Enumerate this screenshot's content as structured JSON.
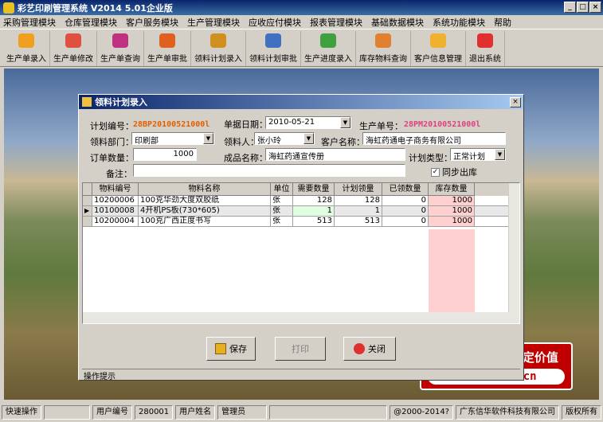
{
  "window": {
    "title": "彩艺印刷管理系统  V2014 5.01企业版"
  },
  "menu": [
    "采购管理模块",
    "仓库管理模块",
    "客户服务模块",
    "生产管理模块",
    "应收应付模块",
    "报表管理模块",
    "基础数据模块",
    "系统功能模块",
    "帮助"
  ],
  "toolbar": [
    {
      "label": "生产单录入",
      "color": "#f0a020"
    },
    {
      "label": "生产单修改",
      "color": "#e05040"
    },
    {
      "label": "生产单查询",
      "color": "#c03080"
    },
    {
      "label": "生产单审批",
      "color": "#e06020"
    },
    {
      "label": "领料计划录入",
      "color": "#d09020"
    },
    {
      "label": "领料计划审批",
      "color": "#4070c0"
    },
    {
      "label": "生产进度录入",
      "color": "#40a040"
    },
    {
      "label": "库存物料查询",
      "color": "#e08030"
    },
    {
      "label": "客户信息管理",
      "color": "#f0b030"
    },
    {
      "label": "退出系统",
      "color": "#e03030"
    }
  ],
  "dialog": {
    "title": "领料计划录入",
    "plan_no_label": "计划编号：",
    "plan_no": "28BP20100521000l",
    "date_label": "单据日期：",
    "date": "2010-05-21",
    "prod_no_label": "生产单号：",
    "prod_no": "28PM20100521000l",
    "dept_label": "领料部门：",
    "dept": "印刷部",
    "person_label": "领料人：",
    "person": "张小玲",
    "customer_label": "客户名称：",
    "customer": "海虹药通电子商务有限公司",
    "qty_label": "订单数量：",
    "qty": "1000",
    "product_label": "成品名称：",
    "product": "海虹药通宣传册",
    "plan_type_label": "计划类型：",
    "plan_type": "正常计划",
    "remark_label": "备注：",
    "sync_label": "同步出库",
    "columns": [
      "物料编号",
      "物料名称",
      "单位",
      "需要数量",
      "计划领量",
      "已领数量",
      "库存数量"
    ],
    "rows": [
      [
        "10200006",
        "100克华劲大度双胶纸",
        "张",
        "128",
        "128",
        "0",
        "1000"
      ],
      [
        "10100008",
        "4开机PS板(730*605)",
        "张",
        "1",
        "1",
        "0",
        "1000"
      ],
      [
        "10200004",
        "100克广西正度书写",
        "张",
        "513",
        "513",
        "0",
        "1000"
      ]
    ],
    "save_label": "保存",
    "print_label": "打印",
    "close_label": "关闭",
    "hint_label": "操作提示"
  },
  "banner": {
    "line1": "信华软件·品质决定价值",
    "line2": "www.xinwa.cn"
  },
  "status": {
    "quick": "快速操作",
    "uid_label": "用户编号",
    "uid": "280001",
    "uname_label": "用户姓名",
    "uname": "管理员",
    "copyright": "@2000-2014?",
    "company": "广东信华软件科技有限公司",
    "rights": "版权所有"
  }
}
